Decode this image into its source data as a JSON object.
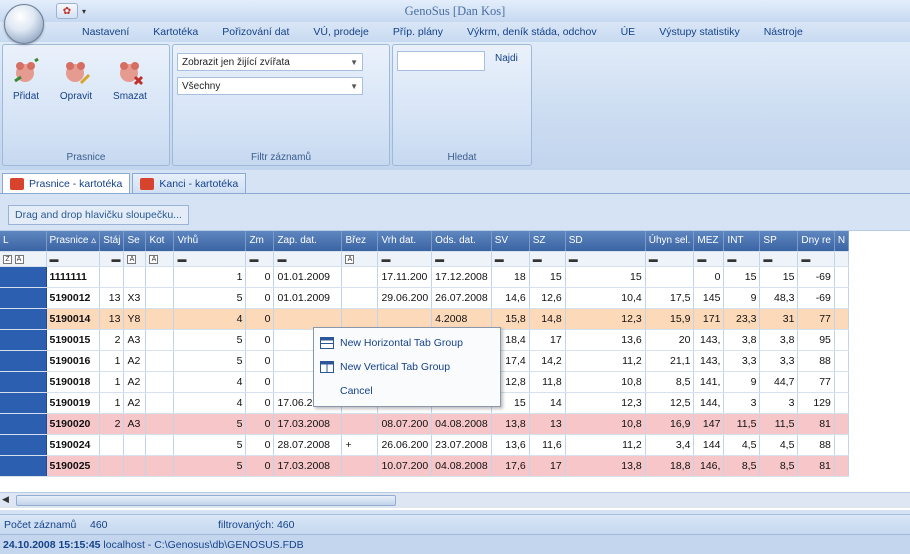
{
  "app": {
    "title": "GenoSus",
    "user": "[Dan Kos]"
  },
  "menu": [
    "Nastavení",
    "Kartotéka",
    "Pořizování dat",
    "VÚ, prodeje",
    "Příp. plány",
    "Výkrm, deník stáda, odchov",
    "ÚE",
    "Výstupy statistiky",
    "Nástroje"
  ],
  "ribbon": {
    "prasnice": {
      "label": "Prasnice",
      "add": "Přidat",
      "edit": "Opravit",
      "delete": "Smazat"
    },
    "filtr": {
      "label": "Filtr záznamů",
      "combo1": "Zobrazit jen žijící zvířata",
      "combo2": "Všechny"
    },
    "hledat": {
      "label": "Hledat",
      "find": "Najdi"
    }
  },
  "tabs": [
    "Prasnice - kartotéka",
    "Kanci - kartotéka"
  ],
  "drag_hint": "Drag and drop hlavičku sloupečku...",
  "columns": [
    "L",
    "Prasnice ▵",
    "Stáj",
    "Se",
    "Kot",
    "Vrhů",
    "Zm",
    "Zap. dat.",
    "Břez",
    "Vrh dat.",
    "Ods. dat.",
    "SV",
    "SZ",
    "SD",
    "Úhyn sel.",
    "MEZ",
    "INT",
    "SP",
    "Dny re",
    "N"
  ],
  "rows": [
    [
      "",
      "1111111",
      "",
      "",
      "",
      "1",
      "0",
      "01.01.2009",
      "",
      "17.11.200",
      "17.12.2008",
      "18",
      "15",
      "15",
      "",
      "0",
      "15",
      "15",
      "-69"
    ],
    [
      "",
      "5190012",
      "13",
      "X3",
      "",
      "5",
      "0",
      "01.01.2009",
      "",
      "29.06.200",
      "26.07.2008",
      "14,6",
      "12,6",
      "10,4",
      "17,5",
      "145",
      "9",
      "48,3",
      "-69"
    ],
    [
      "",
      "5190014",
      "13",
      "Y8",
      "",
      "4",
      "0",
      "",
      "",
      "",
      "4.2008",
      "15,8",
      "14,8",
      "12,3",
      "15,9",
      "171",
      "23,3",
      "31",
      "77"
    ],
    [
      "",
      "5190015",
      "2",
      "A3",
      "",
      "5",
      "0",
      "",
      "",
      "",
      "7.2008",
      "18,4",
      "17",
      "13,6",
      "20",
      "143,",
      "3,8",
      "3,8",
      "95"
    ],
    [
      "",
      "5190016",
      "1",
      "A2",
      "",
      "5",
      "0",
      "",
      "",
      "",
      "7.2008",
      "17,4",
      "14,2",
      "11,2",
      "21,1",
      "143,",
      "3,3",
      "3,3",
      "88"
    ],
    [
      "",
      "5190018",
      "1",
      "A2",
      "",
      "4",
      "0",
      "",
      "",
      "",
      "4.2008",
      "12,8",
      "11,8",
      "10,8",
      "8,5",
      "141,",
      "9",
      "44,7",
      "77"
    ],
    [
      "",
      "5190019",
      "1",
      "A2",
      "",
      "4",
      "0",
      "17.06.2008",
      "",
      "17.05.200",
      "11.06.2008",
      "15",
      "14",
      "12,3",
      "12,5",
      "144,",
      "3",
      "3",
      "129"
    ],
    [
      "",
      "5190020",
      "2",
      "A3",
      "",
      "5",
      "0",
      "17.03.2008",
      "",
      "08.07.200",
      "04.08.2008",
      "13,8",
      "13",
      "10,8",
      "16,9",
      "147",
      "11,5",
      "11,5",
      "81"
    ],
    [
      "",
      "5190024",
      "",
      "",
      "",
      "5",
      "0",
      "28.07.2008",
      "+",
      "26.06.200",
      "23.07.2008",
      "13,6",
      "11,6",
      "11,2",
      "3,4",
      "144",
      "4,5",
      "4,5",
      "88"
    ],
    [
      "",
      "5190025",
      "",
      "",
      "",
      "5",
      "0",
      "17.03.2008",
      "",
      "10.07.200",
      "04.08.2008",
      "17,6",
      "17",
      "13,8",
      "18,8",
      "146,",
      "8,5",
      "8,5",
      "81"
    ]
  ],
  "context_menu": [
    "New Horizontal Tab Group",
    "New Vertical Tab Group",
    "Cancel"
  ],
  "status": {
    "count_label": "Počet záznamů",
    "count": "460",
    "filtered": "filtrovaných: 460"
  },
  "path": {
    "datetime": "24.10.2008 15:15:45",
    "info": "localhost - C:\\Genosus\\db\\GENOSUS.FDB"
  }
}
